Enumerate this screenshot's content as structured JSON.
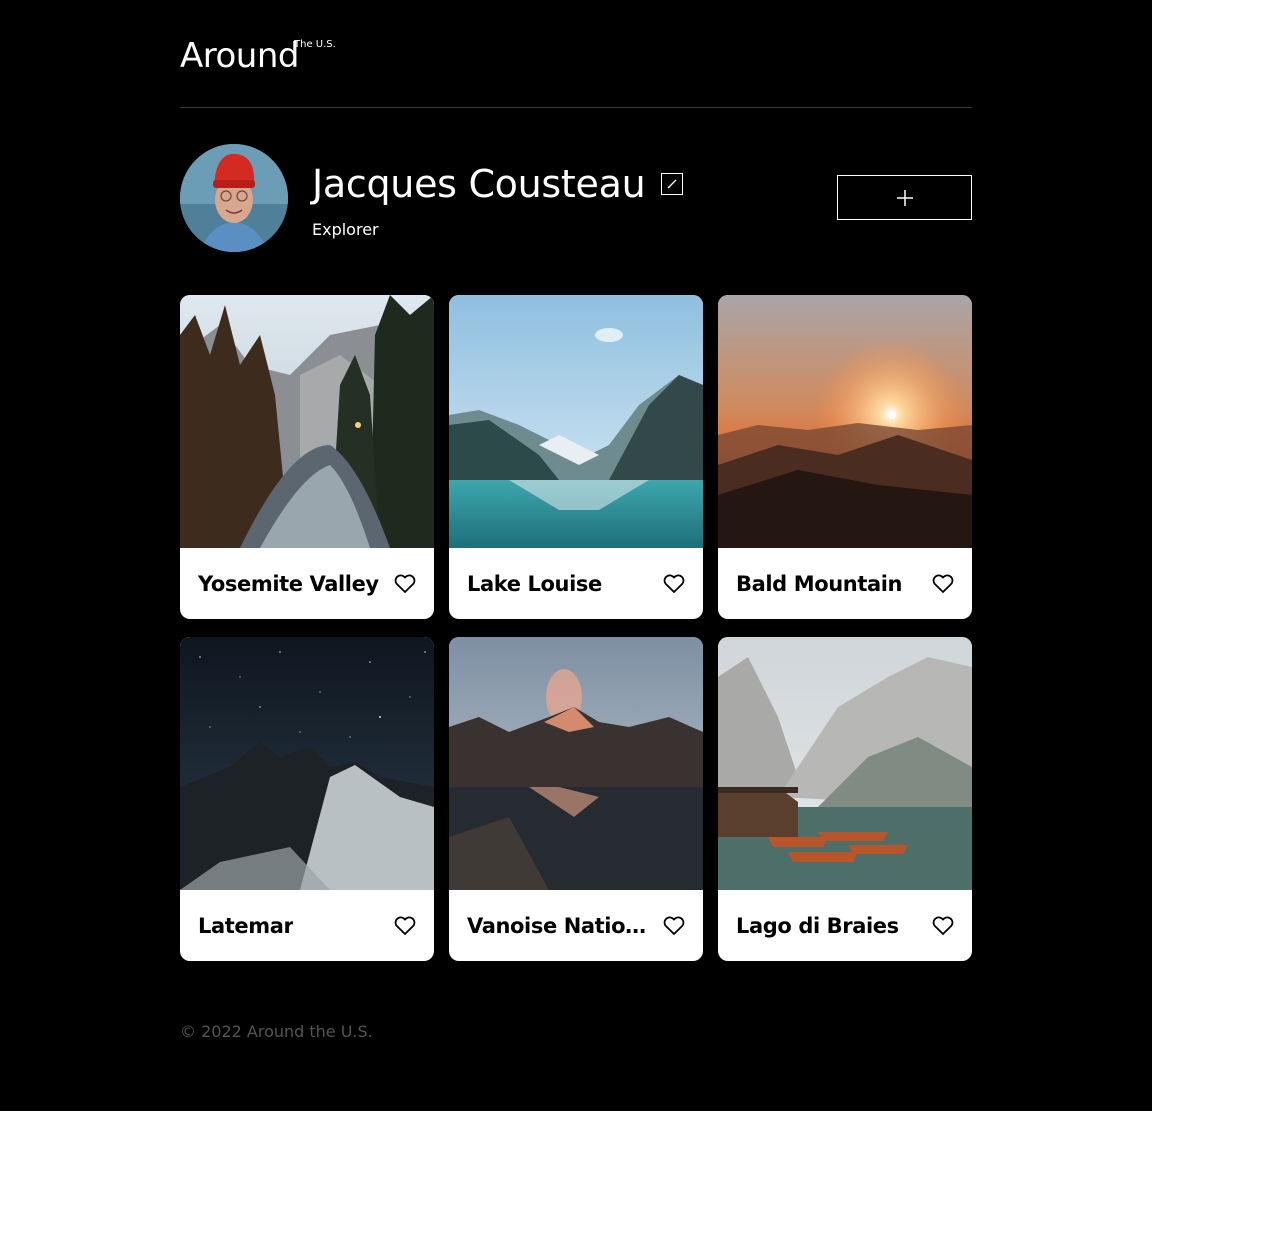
{
  "header": {
    "logo_main": "Around",
    "logo_sup": "The U.S."
  },
  "profile": {
    "name": "Jacques Cousteau",
    "job": "Explorer",
    "edit_icon": "pencil-icon",
    "add_icon": "plus-icon"
  },
  "cards": [
    {
      "title": "Yosemite Valley",
      "scene": "forest-river",
      "like_icon": "heart-icon"
    },
    {
      "title": "Lake Louise",
      "scene": "turquoise-lake",
      "like_icon": "heart-icon"
    },
    {
      "title": "Bald Mountain",
      "scene": "sunset-mountains",
      "like_icon": "heart-icon"
    },
    {
      "title": "Latemar",
      "scene": "night-peaks",
      "like_icon": "heart-icon"
    },
    {
      "title": "Vanoise National Park",
      "scene": "dusk-lake",
      "like_icon": "heart-icon"
    },
    {
      "title": "Lago di Braies",
      "scene": "lake-boats",
      "like_icon": "heart-icon"
    }
  ],
  "footer": {
    "copyright": "© 2022 Around the U.S."
  },
  "colors": {
    "page_background": "#000000",
    "card_background": "#ffffff",
    "footer_text": "#545454",
    "divider": "#545454"
  }
}
